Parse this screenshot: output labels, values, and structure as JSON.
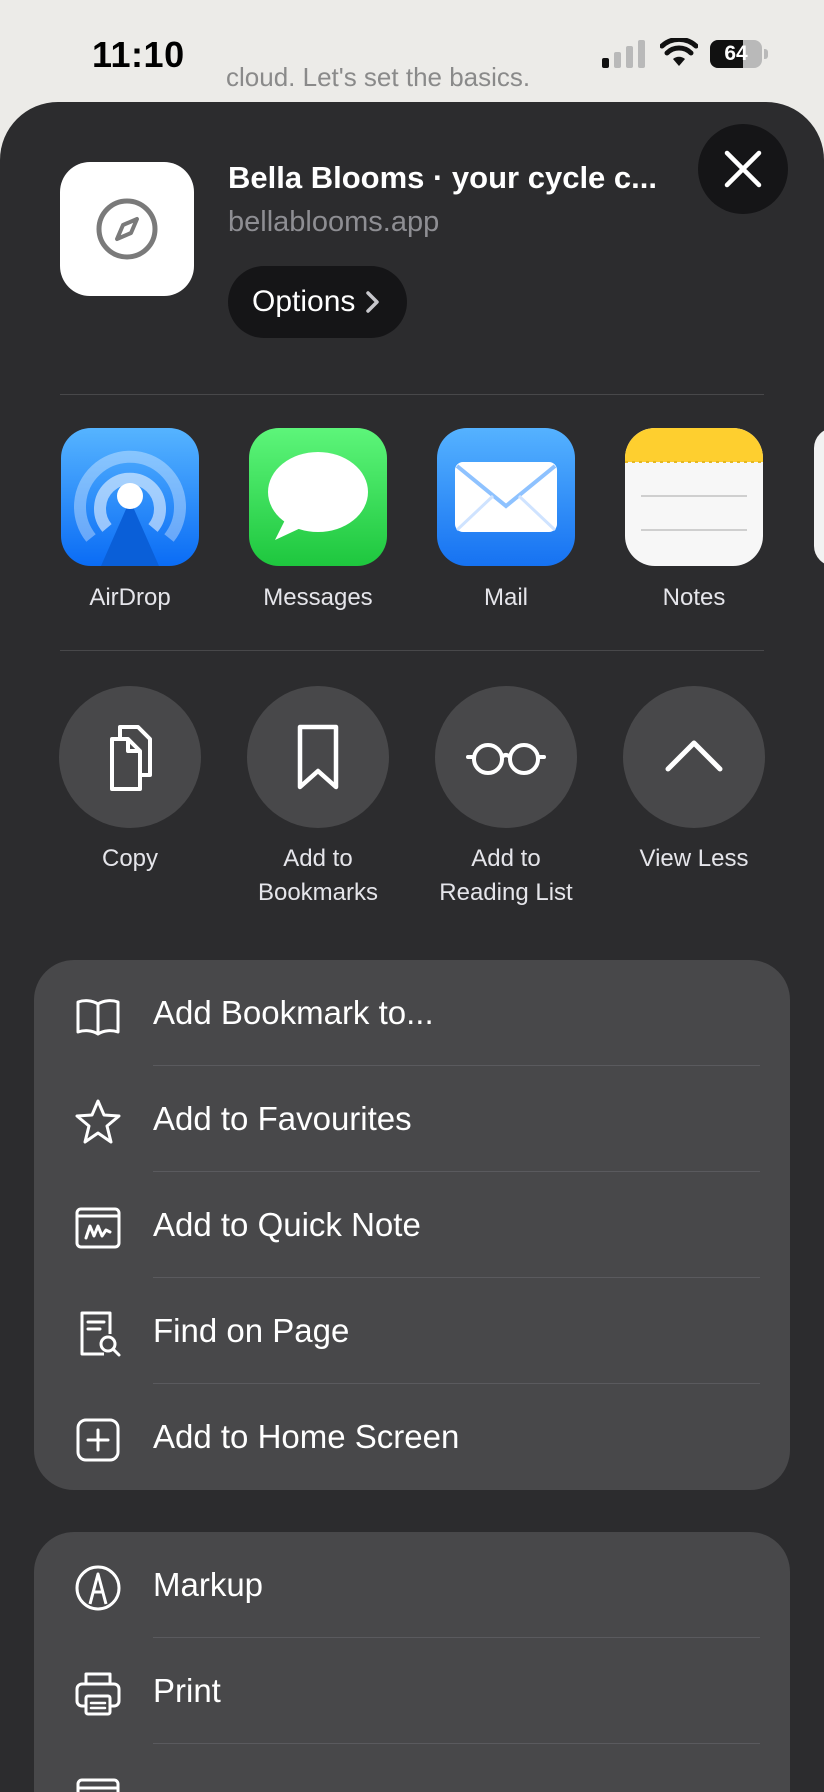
{
  "status": {
    "time": "11:10",
    "battery": "64",
    "battery_level": 0.64
  },
  "background_text": "cloud. Let's set the basics.",
  "share_header": {
    "title": "Bella Blooms · your cycle c...",
    "subtitle": "bellablooms.app",
    "options_label": "Options"
  },
  "apps": [
    {
      "label": "AirDrop"
    },
    {
      "label": "Messages"
    },
    {
      "label": "Mail"
    },
    {
      "label": "Notes"
    }
  ],
  "actions": [
    {
      "label": "Copy"
    },
    {
      "label": "Add to\nBookmarks"
    },
    {
      "label": "Add to\nReading List"
    },
    {
      "label": "View Less"
    }
  ],
  "menu_group_1": [
    {
      "label": "Add Bookmark to..."
    },
    {
      "label": "Add to Favourites"
    },
    {
      "label": "Add to Quick Note"
    },
    {
      "label": "Find on Page"
    },
    {
      "label": "Add to Home Screen"
    }
  ],
  "menu_group_2": [
    {
      "label": "Markup"
    },
    {
      "label": "Print"
    }
  ],
  "colors": {
    "sheet": "#2c2c2e",
    "menu": "#48484a",
    "accent_blue": "#0a6cf5"
  }
}
